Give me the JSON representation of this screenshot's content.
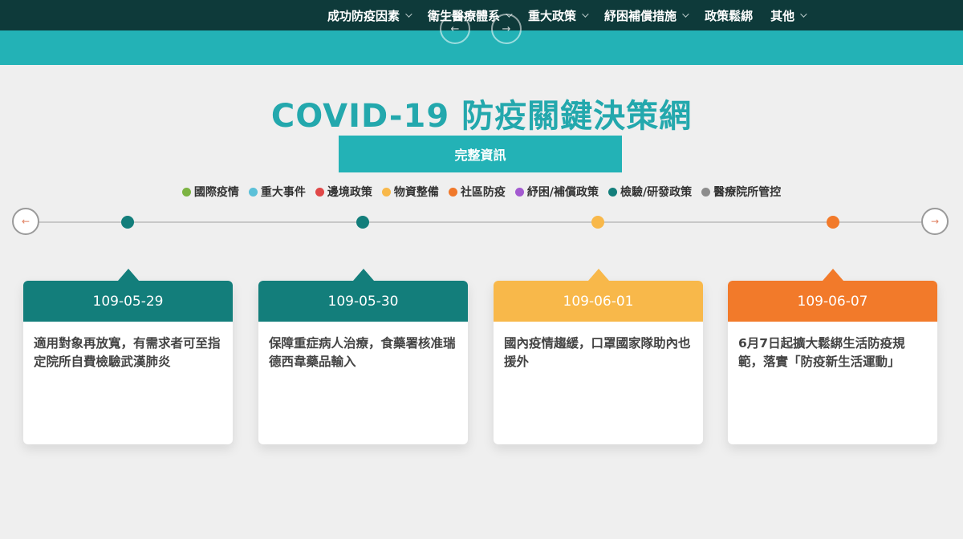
{
  "nav": {
    "items": [
      {
        "label": "成功防疫因素",
        "has_dropdown": true
      },
      {
        "label": "衛生醫療體系",
        "has_dropdown": true
      },
      {
        "label": "重大政策",
        "has_dropdown": true
      },
      {
        "label": "紓困補償措施",
        "has_dropdown": true
      },
      {
        "label": "政策鬆綁",
        "has_dropdown": false
      },
      {
        "label": "其他",
        "has_dropdown": true
      }
    ]
  },
  "header": {
    "title": "COVID-19 防疫關鍵決策網",
    "full_info_label": "完整資訊"
  },
  "legend": [
    {
      "label": "國際疫情",
      "color": "#7cb342"
    },
    {
      "label": "重大事件",
      "color": "#5bc0d8"
    },
    {
      "label": "邊境政策",
      "color": "#e04848"
    },
    {
      "label": "物資整備",
      "color": "#f8b84a"
    },
    {
      "label": "社區防疫",
      "color": "#f0782a"
    },
    {
      "label": "紓困/補償政策",
      "color": "#a35ad0"
    },
    {
      "label": "檢驗/研發政策",
      "color": "#137e7b"
    },
    {
      "label": "醫療院所管控",
      "color": "#8c8c8c"
    }
  ],
  "timeline": {
    "prev_icon": "arrow-left-icon",
    "next_icon": "arrow-right-icon",
    "events": [
      {
        "date": "109-05-29",
        "text": "適用對象再放寬，有需求者可至指定院所自費檢驗武漢肺炎",
        "color": "#137e7b"
      },
      {
        "date": "109-05-30",
        "text": "保障重症病人治療，食藥署核准瑞德西韋藥品輸入",
        "color": "#137e7b"
      },
      {
        "date": "109-06-01",
        "text": "國內疫情趨緩，口罩國家隊助內也援外",
        "color": "#f8b84a"
      },
      {
        "date": "109-06-07",
        "text": "6月7日起擴大鬆綁生活防疫規範，落實「防疫新生活運動」",
        "color": "#f27a2a"
      }
    ]
  }
}
